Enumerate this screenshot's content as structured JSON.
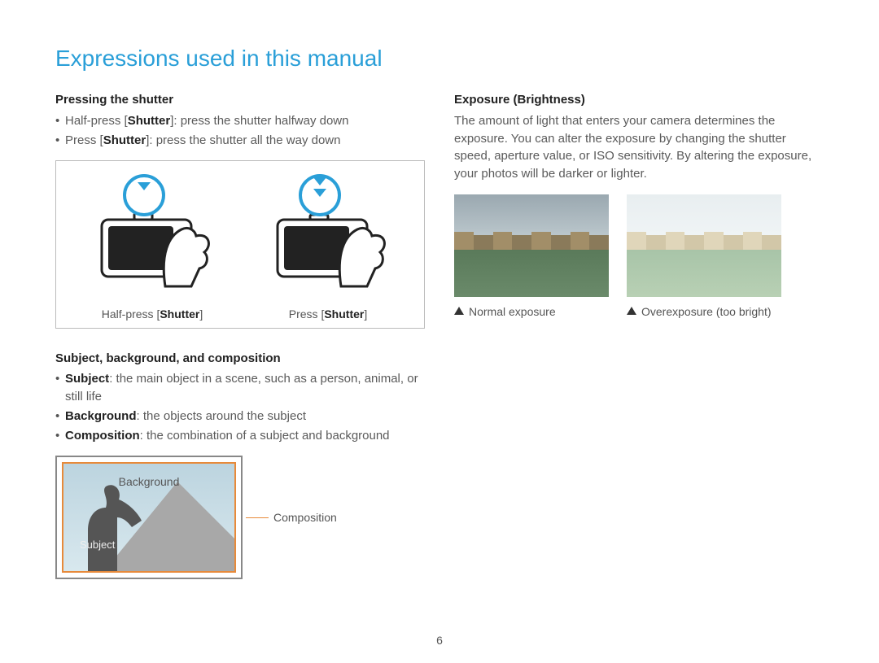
{
  "title": "Expressions used in this manual",
  "pageNumber": "6",
  "left": {
    "shutter": {
      "heading": "Pressing the shutter",
      "halfPrefix": "Half-press [",
      "halfBold": "Shutter",
      "halfSuffix": "]: press the shutter halfway down",
      "fullPrefix": "Press [",
      "fullBold": "Shutter",
      "fullSuffix": "]: press the shutter all the way down",
      "capHalfPrefix": "Half-press [",
      "capHalfBold": "Shutter",
      "capHalfSuffix": "]",
      "capFullPrefix": "Press [",
      "capFullBold": "Shutter",
      "capFullSuffix": "]"
    },
    "comp": {
      "heading": "Subject, background, and composition",
      "subjBold": "Subject",
      "subjText": ": the main object in a scene, such as a person, animal, or still life",
      "bgBold": "Background",
      "bgText": ": the objects around the subject",
      "compBold": "Composition",
      "compText": ": the combination of a subject and background",
      "labelBackground": "Background",
      "labelSubject": "Subject",
      "labelComposition": "Composition"
    }
  },
  "right": {
    "exposure": {
      "heading": "Exposure (Brightness)",
      "para": "The amount of light that enters your camera determines the exposure. You can alter the exposure by changing the shutter speed, aperture value, or ISO sensitivity. By altering the exposure, your photos will be darker or lighter.",
      "capNormal": "Normal exposure",
      "capOver": "Overexposure (too bright)"
    }
  }
}
